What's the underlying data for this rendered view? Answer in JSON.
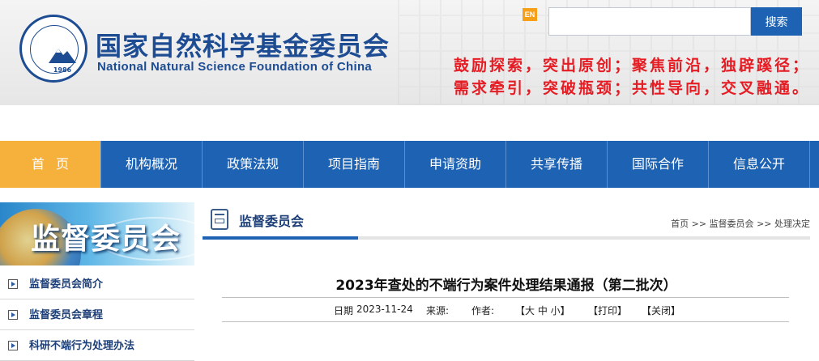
{
  "header": {
    "title": "国家自然科学基金委员会",
    "subtitle": "National Natural Science Foundation of China",
    "logo_year": "1986",
    "en_label": "EN",
    "search": {
      "value": "",
      "placeholder": "",
      "button_label": "搜索"
    },
    "slogan_line1": "鼓励探索，突出原创；聚焦前沿，独辟蹊径；",
    "slogan_line2": "需求牵引，突破瓶颈；共性导向，交叉融通。"
  },
  "nav": {
    "items": [
      "首页",
      "机构概况",
      "政策法规",
      "项目指南",
      "申请资助",
      "共享传播",
      "国际合作",
      "信息公开"
    ],
    "active_index": 0
  },
  "sidebar": {
    "banner_title": "监督委员会",
    "items": [
      "监督委员会简介",
      "监督委员会章程",
      "科研不端行为处理办法"
    ]
  },
  "content": {
    "section_title": "监督委员会",
    "breadcrumb": [
      "首页",
      "监督委员会",
      "处理决定"
    ],
    "breadcrumb_sep": ">>",
    "article_title": "2023年查处的不端行为案件处理结果通报（第二批次）",
    "meta": {
      "date_label": "日期",
      "date": "2023-11-24",
      "source_label": "来源:",
      "author_label": "作者:",
      "font_size": "【大 中 小】",
      "print": "【打印】",
      "close": "【关闭】"
    }
  },
  "colors": {
    "brand_blue": "#1d4c92",
    "nav_blue": "#1e63b3",
    "nav_active": "#f6b13c",
    "slogan_red": "#e51c23"
  }
}
